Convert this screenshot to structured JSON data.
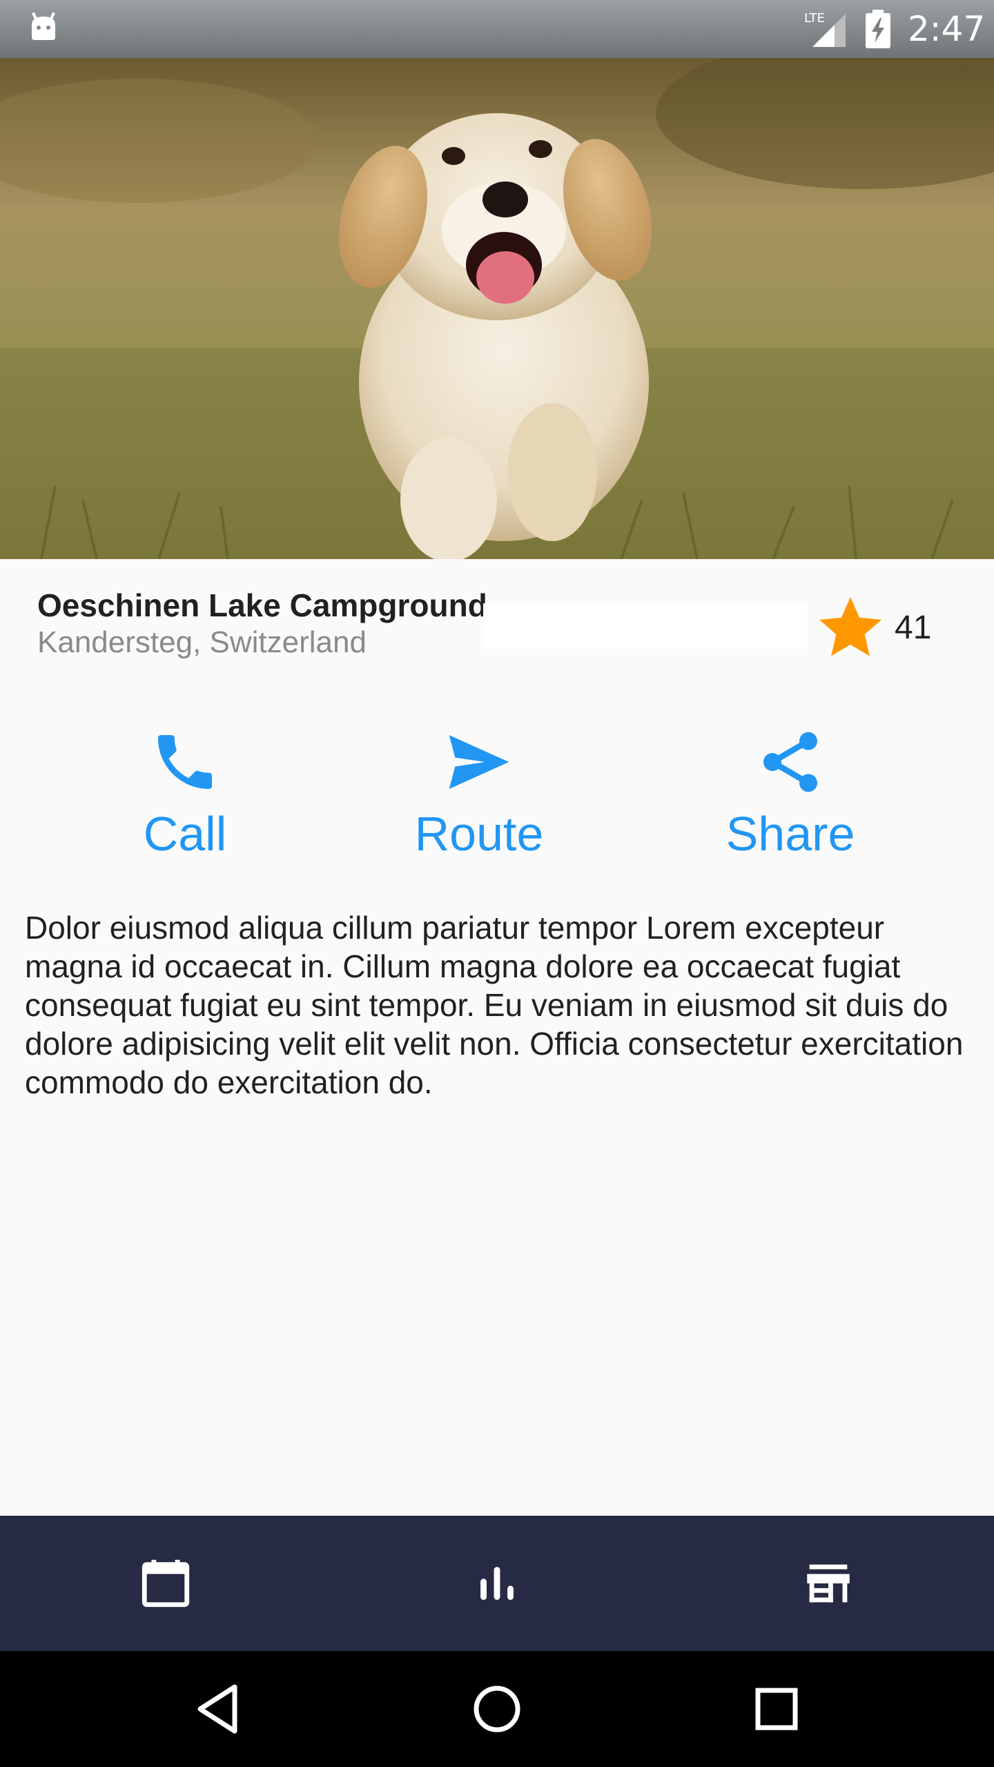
{
  "status_bar": {
    "time": "2:47",
    "network": "LTE",
    "icons": [
      "android-icon",
      "lte-signal-icon",
      "battery-charging-icon"
    ]
  },
  "hero": {
    "subject": "puppy running on grass"
  },
  "place": {
    "name": "Oeschinen Lake Campground",
    "location": "Kandersteg, Switzerland",
    "rating_count": "41",
    "star_color": "#ff9800"
  },
  "actions": [
    {
      "label": "Call",
      "icon": "phone-icon"
    },
    {
      "label": "Route",
      "icon": "send-icon"
    },
    {
      "label": "Share",
      "icon": "share-icon"
    }
  ],
  "accent_color": "#2196f3",
  "description": "Dolor eiusmod aliqua cillum pariatur tempor Lorem excepteur magna id occaecat in. Cillum magna dolore ea occaecat fugiat consequat fugiat eu sint tempor. Eu veniam in eiusmod sit duis do dolore adipisicing velit elit velit non. Officia consectetur exercitation commodo do exercitation do.",
  "bottom_nav": {
    "background": "#262a43",
    "items": [
      {
        "icon": "calendar-icon"
      },
      {
        "icon": "bar-chart-icon"
      },
      {
        "icon": "store-icon"
      }
    ]
  },
  "system_nav": {
    "buttons": [
      "back-icon",
      "home-icon",
      "recents-icon"
    ]
  }
}
